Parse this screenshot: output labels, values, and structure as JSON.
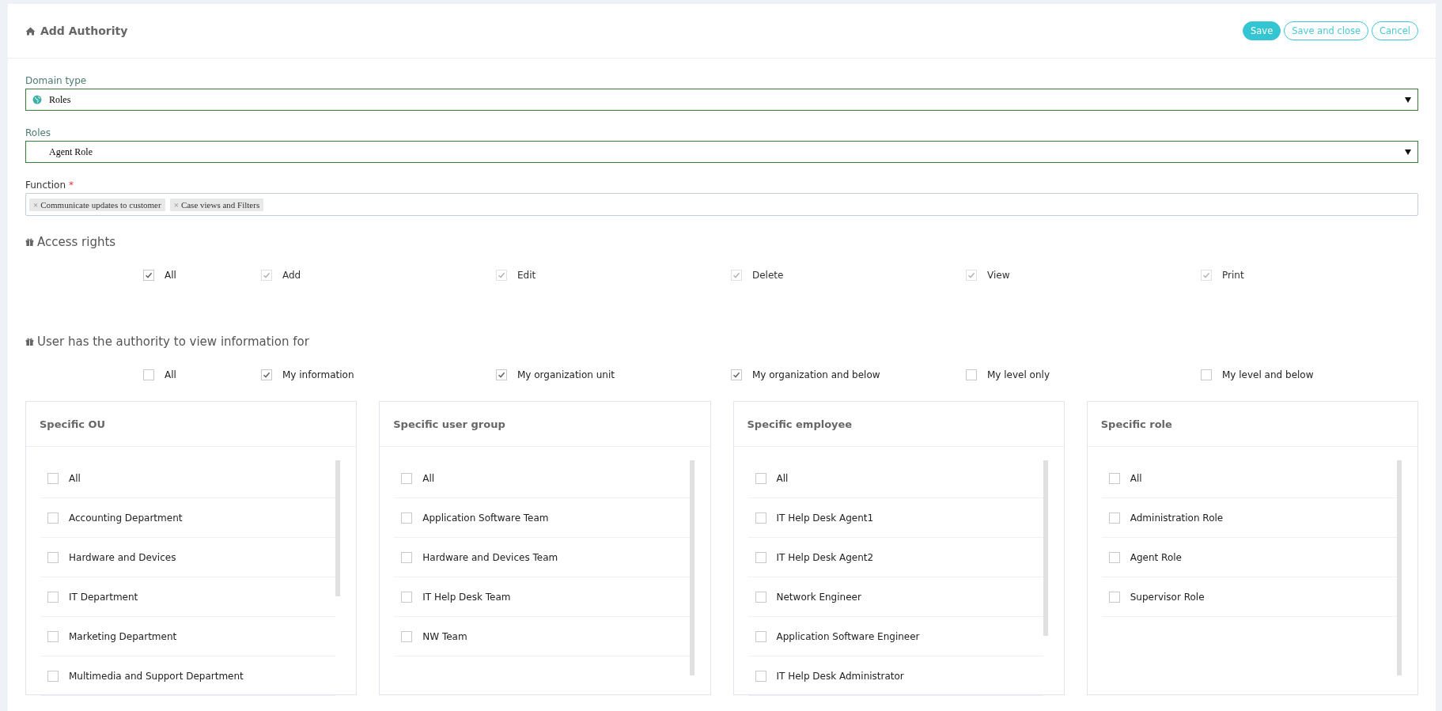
{
  "header": {
    "title": "Add Authority",
    "buttons": [
      {
        "label": "Save",
        "kind": "primary"
      },
      {
        "label": "Save and close",
        "kind": "outline"
      },
      {
        "label": "Cancel",
        "kind": "outline"
      }
    ]
  },
  "form": {
    "domain_type": {
      "label": "Domain type",
      "value": "Roles"
    },
    "roles": {
      "label": "Roles",
      "value": "Agent Role"
    },
    "function": {
      "label": "Function",
      "required_mark": "*",
      "tags": [
        {
          "label": "Communicate updates to customer",
          "remove": "×"
        },
        {
          "label": "Case views and Filters",
          "remove": "×"
        }
      ]
    }
  },
  "access_rights": {
    "heading": "Access rights",
    "options": [
      {
        "label": "All",
        "checked": true,
        "disabled": false
      },
      {
        "label": "Add",
        "checked": true,
        "disabled": true
      },
      {
        "label": "Edit",
        "checked": true,
        "disabled": true
      },
      {
        "label": "Delete",
        "checked": true,
        "disabled": true
      },
      {
        "label": "View",
        "checked": true,
        "disabled": true
      },
      {
        "label": "Print",
        "checked": true,
        "disabled": true
      }
    ]
  },
  "view_authority": {
    "heading": "User has the authority to view information for",
    "options": [
      {
        "label": "All",
        "checked": false,
        "disabled": false
      },
      {
        "label": "My information",
        "checked": true,
        "disabled": false
      },
      {
        "label": "My organization unit",
        "checked": true,
        "disabled": false
      },
      {
        "label": "My organization and below",
        "checked": true,
        "disabled": false
      },
      {
        "label": "My level only",
        "checked": false,
        "disabled": false
      },
      {
        "label": "My level and below",
        "checked": false,
        "disabled": false
      }
    ]
  },
  "panels": [
    {
      "title": "Specific OU",
      "items": [
        {
          "label": "All",
          "checked": false
        },
        {
          "label": "Accounting Department",
          "checked": false
        },
        {
          "label": "Hardware and Devices",
          "checked": false
        },
        {
          "label": "IT Department",
          "checked": false
        },
        {
          "label": "Marketing Department",
          "checked": false
        },
        {
          "label": "Multimedia and Support Department",
          "checked": false
        }
      ]
    },
    {
      "title": "Specific user group",
      "items": [
        {
          "label": "All",
          "checked": false
        },
        {
          "label": "Application Software Team",
          "checked": false
        },
        {
          "label": "Hardware and Devices Team",
          "checked": false
        },
        {
          "label": "IT Help Desk Team",
          "checked": false
        },
        {
          "label": "NW Team",
          "checked": false
        }
      ]
    },
    {
      "title": "Specific employee",
      "items": [
        {
          "label": "All",
          "checked": false
        },
        {
          "label": "IT Help Desk Agent1",
          "checked": false
        },
        {
          "label": "IT Help Desk Agent2",
          "checked": false
        },
        {
          "label": "Network Engineer",
          "checked": false
        },
        {
          "label": "Application Software Engineer",
          "checked": false
        },
        {
          "label": "IT Help Desk Administrator",
          "checked": false
        }
      ]
    },
    {
      "title": "Specific role",
      "items": [
        {
          "label": "All",
          "checked": false
        },
        {
          "label": "Administration Role",
          "checked": false
        },
        {
          "label": "Agent Role",
          "checked": false
        },
        {
          "label": "Supervisor Role",
          "checked": false
        }
      ]
    }
  ]
}
